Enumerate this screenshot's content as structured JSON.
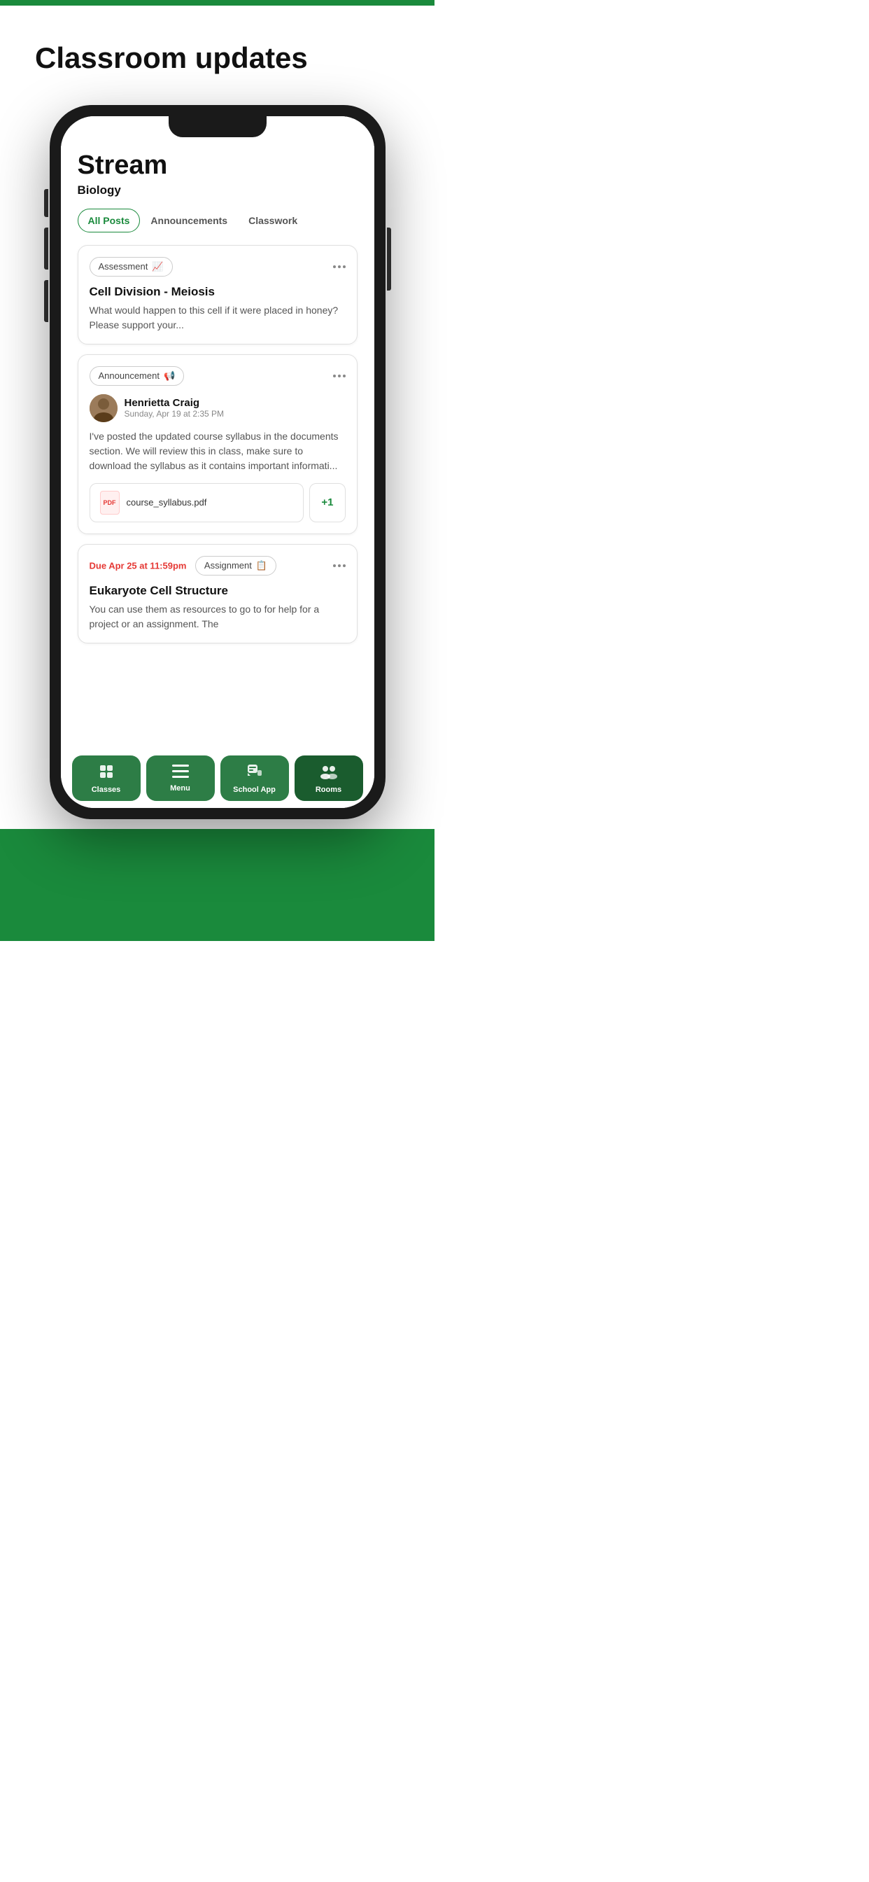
{
  "page": {
    "title": "Classroom updates",
    "top_bar_color": "#1a8a3c",
    "bottom_bg_color": "#1a8a3c",
    "bg_color": "#ffffff"
  },
  "app": {
    "screen_title": "Stream",
    "subject": "Biology",
    "tabs": [
      {
        "label": "All Posts",
        "active": true
      },
      {
        "label": "Announcements",
        "active": false
      },
      {
        "label": "Classwork",
        "active": false
      }
    ],
    "cards": [
      {
        "type": "assessment",
        "badge": "Assessment",
        "title": "Cell Division - Meiosis",
        "body": "What would happen to this cell if it were placed in honey? Please support your..."
      },
      {
        "type": "announcement",
        "badge": "Announcement",
        "author_name": "Henrietta Craig",
        "author_date": "Sunday, Apr 19 at 2:35 PM",
        "body": "I've posted the updated course syllabus in the documents section. We will review this in class, make sure to download the syllabus as it contains important informati...",
        "attachment_name": "course_syllabus.pdf",
        "attachment_plus": "+1"
      },
      {
        "type": "assignment",
        "due_label": "Due Apr 25 at 11:59pm",
        "badge": "Assignment",
        "title": "Eukaryote Cell Structure",
        "body": "You can use them as resources to go to for help for a project or an assignment. The"
      }
    ],
    "nav": [
      {
        "label": "Classes",
        "icon": "📋",
        "active": false
      },
      {
        "label": "Menu",
        "icon": "☰",
        "active": false
      },
      {
        "label": "School App",
        "icon": "💬",
        "active": false
      },
      {
        "label": "Rooms",
        "icon": "👥",
        "active": true
      }
    ]
  }
}
